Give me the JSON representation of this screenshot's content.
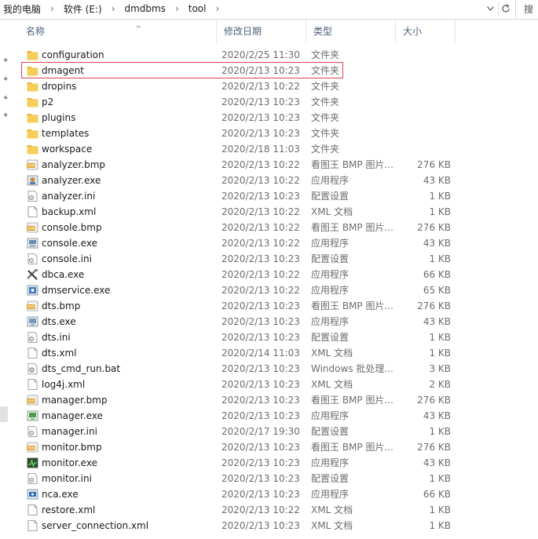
{
  "address": {
    "crumbs": [
      "我的电脑",
      "软件 (E:)",
      "dmdbms",
      "tool"
    ],
    "search_label": "搜"
  },
  "columns": {
    "name": "名称",
    "date": "修改日期",
    "type": "类型",
    "size": "大小"
  },
  "files": [
    {
      "name": "configuration",
      "date": "2020/2/25 11:30",
      "type": "文件夹",
      "size": "",
      "icon": "folder-icon"
    },
    {
      "name": "dmagent",
      "date": "2020/2/13 10:23",
      "type": "文件夹",
      "size": "",
      "icon": "folder-icon"
    },
    {
      "name": "dropins",
      "date": "2020/2/13 10:22",
      "type": "文件夹",
      "size": "",
      "icon": "folder-icon"
    },
    {
      "name": "p2",
      "date": "2020/2/13 10:23",
      "type": "文件夹",
      "size": "",
      "icon": "folder-icon"
    },
    {
      "name": "plugins",
      "date": "2020/2/13 10:23",
      "type": "文件夹",
      "size": "",
      "icon": "folder-icon"
    },
    {
      "name": "templates",
      "date": "2020/2/13 10:23",
      "type": "文件夹",
      "size": "",
      "icon": "folder-icon"
    },
    {
      "name": "workspace",
      "date": "2020/2/18 11:03",
      "type": "文件夹",
      "size": "",
      "icon": "folder-icon"
    },
    {
      "name": "analyzer.bmp",
      "date": "2020/2/13 10:22",
      "type": "看图王 BMP 图片...",
      "size": "276 KB",
      "icon": "bmp-icon"
    },
    {
      "name": "analyzer.exe",
      "date": "2020/2/13 10:22",
      "type": "应用程序",
      "size": "43 KB",
      "icon": "analyzer-exe-icon"
    },
    {
      "name": "analyzer.ini",
      "date": "2020/2/13 10:23",
      "type": "配置设置",
      "size": "1 KB",
      "icon": "ini-icon"
    },
    {
      "name": "backup.xml",
      "date": "2020/2/13 10:22",
      "type": "XML 文档",
      "size": "1 KB",
      "icon": "xml-icon"
    },
    {
      "name": "console.bmp",
      "date": "2020/2/13 10:22",
      "type": "看图王 BMP 图片...",
      "size": "276 KB",
      "icon": "bmp-icon"
    },
    {
      "name": "console.exe",
      "date": "2020/2/13 10:22",
      "type": "应用程序",
      "size": "43 KB",
      "icon": "console-exe-icon"
    },
    {
      "name": "console.ini",
      "date": "2020/2/13 10:23",
      "type": "配置设置",
      "size": "1 KB",
      "icon": "ini-icon"
    },
    {
      "name": "dbca.exe",
      "date": "2020/2/13 10:22",
      "type": "应用程序",
      "size": "66 KB",
      "icon": "dbca-exe-icon"
    },
    {
      "name": "dmservice.exe",
      "date": "2020/2/13 10:22",
      "type": "应用程序",
      "size": "65 KB",
      "icon": "dmservice-exe-icon"
    },
    {
      "name": "dts.bmp",
      "date": "2020/2/13 10:23",
      "type": "看图王 BMP 图片...",
      "size": "276 KB",
      "icon": "bmp-icon"
    },
    {
      "name": "dts.exe",
      "date": "2020/2/13 10:23",
      "type": "应用程序",
      "size": "43 KB",
      "icon": "dts-exe-icon"
    },
    {
      "name": "dts.ini",
      "date": "2020/2/13 10:23",
      "type": "配置设置",
      "size": "1 KB",
      "icon": "ini-icon"
    },
    {
      "name": "dts.xml",
      "date": "2020/2/14 11:03",
      "type": "XML 文档",
      "size": "1 KB",
      "icon": "xml-icon"
    },
    {
      "name": "dts_cmd_run.bat",
      "date": "2020/2/13 10:23",
      "type": "Windows 批处理...",
      "size": "3 KB",
      "icon": "bat-icon"
    },
    {
      "name": "log4j.xml",
      "date": "2020/2/13 10:23",
      "type": "XML 文档",
      "size": "2 KB",
      "icon": "xml-icon"
    },
    {
      "name": "manager.bmp",
      "date": "2020/2/13 10:23",
      "type": "看图王 BMP 图片...",
      "size": "276 KB",
      "icon": "bmp-icon"
    },
    {
      "name": "manager.exe",
      "date": "2020/2/13 10:23",
      "type": "应用程序",
      "size": "43 KB",
      "icon": "manager-exe-icon"
    },
    {
      "name": "manager.ini",
      "date": "2020/2/17 19:30",
      "type": "配置设置",
      "size": "1 KB",
      "icon": "ini-icon"
    },
    {
      "name": "monitor.bmp",
      "date": "2020/2/13 10:23",
      "type": "看图王 BMP 图片...",
      "size": "276 KB",
      "icon": "bmp-icon"
    },
    {
      "name": "monitor.exe",
      "date": "2020/2/13 10:23",
      "type": "应用程序",
      "size": "43 KB",
      "icon": "monitor-exe-icon"
    },
    {
      "name": "monitor.ini",
      "date": "2020/2/13 10:23",
      "type": "配置设置",
      "size": "1 KB",
      "icon": "ini-icon"
    },
    {
      "name": "nca.exe",
      "date": "2020/2/13 10:23",
      "type": "应用程序",
      "size": "66 KB",
      "icon": "nca-exe-icon"
    },
    {
      "name": "restore.xml",
      "date": "2020/2/13 10:22",
      "type": "XML 文档",
      "size": "1 KB",
      "icon": "xml-icon"
    },
    {
      "name": "server_connection.xml",
      "date": "2020/2/13 10:23",
      "type": "XML 文档",
      "size": "1 KB",
      "icon": "xml-icon"
    }
  ],
  "highlighted_item": "dmagent",
  "colors": {
    "folder": "#f3c84a",
    "highlight_border": "#d9474f",
    "header_text": "#4c607a",
    "bmp": "#e0a020"
  }
}
